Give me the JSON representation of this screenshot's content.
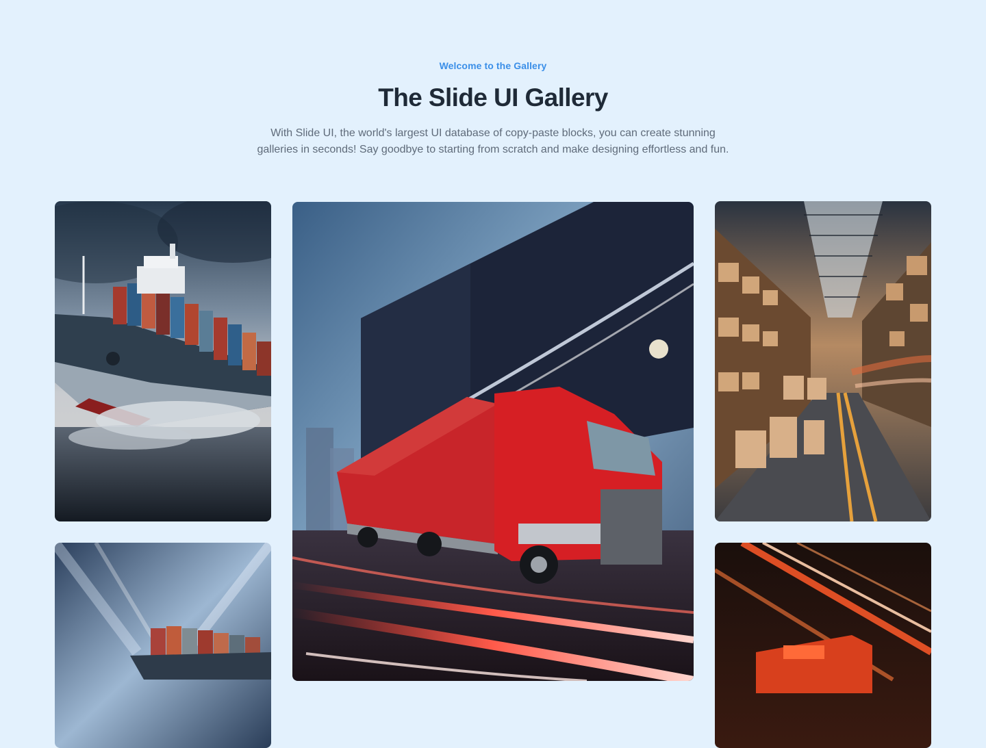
{
  "header": {
    "eyebrow": "Welcome to the Gallery",
    "title": "The Slide UI Gallery",
    "subtitle_line1": "With Slide UI, the world's largest UI database of copy-paste blocks, you can create stunning",
    "subtitle_line2": "galleries in seconds! Say goodbye to starting from scratch and make designing effortless and fun."
  },
  "gallery": {
    "images": [
      {
        "subject": "cargo ship with containers at sea"
      },
      {
        "subject": "red semi truck with light trails"
      },
      {
        "subject": "warehouse aisle with boxes"
      },
      {
        "subject": "container ship under motion-blurred sky"
      },
      {
        "subject": "red truck with orange light streaks"
      }
    ]
  },
  "colors": {
    "background": "#e3f1fd",
    "accent": "#3b8fe8",
    "title": "#1f2a37",
    "body_text": "#5f6b7a"
  }
}
